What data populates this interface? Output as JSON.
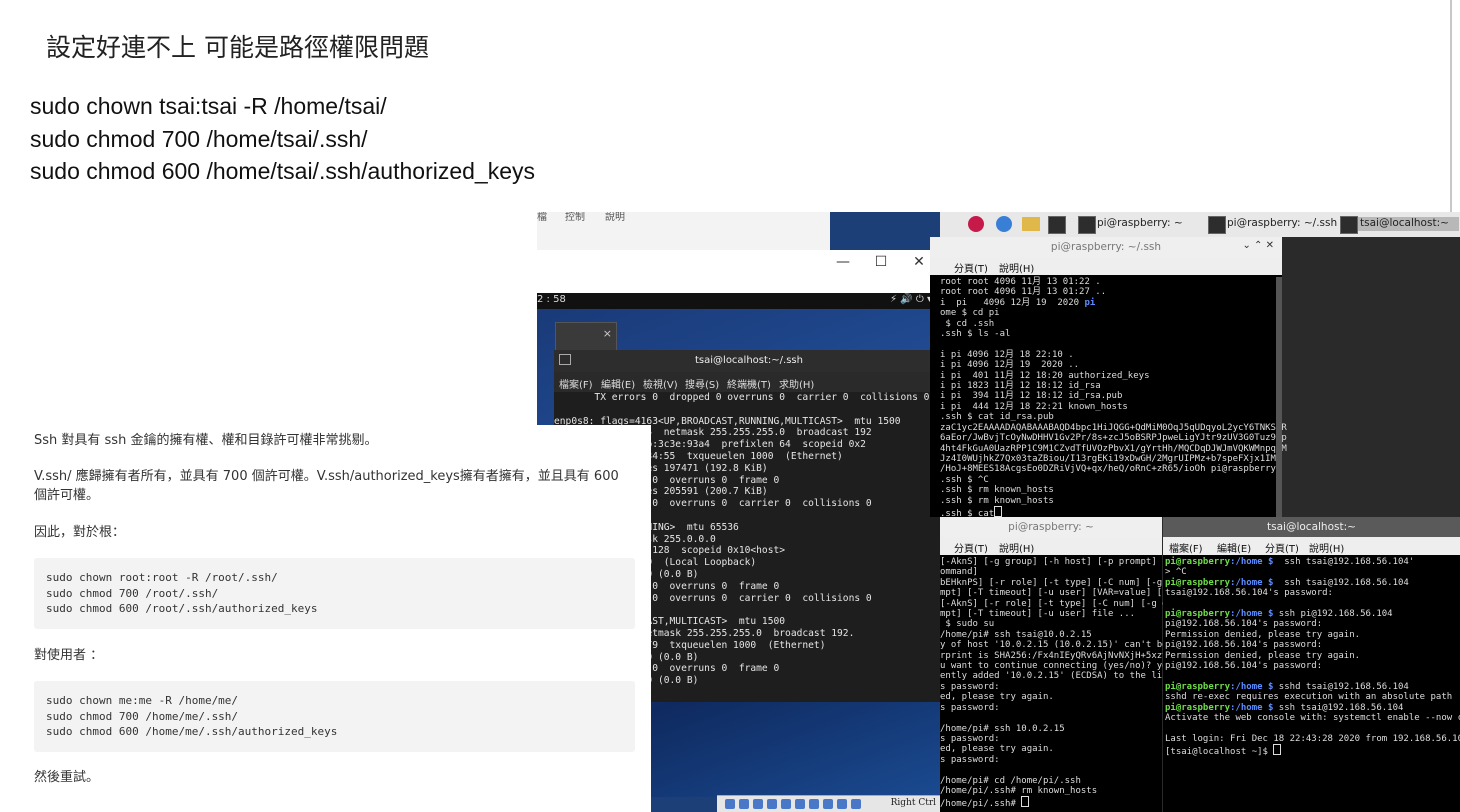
{
  "heading": "設定好連不上 可能是路徑權限問題",
  "commands": [
    "sudo chown tsai:tsai -R /home/tsai/",
    "sudo chmod 700 /home/tsai/.ssh/",
    "sudo chmod 600 /home/tsai/.ssh/authorized_keys"
  ],
  "article": {
    "p1": "Ssh 對具有 ssh 金鑰的擁有權、權和目錄許可權非常挑剔。",
    "p2": "V.ssh/ 應歸擁有者所有，並具有 700 個許可權。V.ssh/authorized_keys擁有者擁有，並且具有 600 個許可權。",
    "p3": "因此，對於根：",
    "code1": "sudo chown root:root -R /root/.ssh/\nsudo chmod 700 /root/.ssh/\nsudo chmod 600 /root/.ssh/authorized_keys",
    "p4": "對使用者 ：",
    "code2": "sudo chown me:me -R /home/me/\nsudo chmod 700 /home/me/.ssh/\nsudo chmod 600 /home/me/.ssh/authorized_keys",
    "p5": "然後重試。"
  },
  "virtualbox": {
    "top_menu": [
      "檔",
      "控制",
      "說明"
    ],
    "min": "—",
    "max": "☐",
    "close": "✕",
    "clock": "2 : 58",
    "right_ctrl": "Right Ctrl"
  },
  "gnome_terminal": {
    "title": "tsai@localhost:~/.ssh",
    "menu": [
      "檔案(F)",
      "編輯(E)",
      "檢視(V)",
      "搜尋(S)",
      "終端機(T)",
      "求助(H)"
    ],
    "output": "       TX errors 0  dropped 0 overruns 0  carrier 0  collisions 0\n\nenp0s8: flags=4163<UP,BROADCAST,RUNNING,MULTICAST>  mtu 1500\n       168.56.104  netmask 255.255.255.0  broadcast 192\n    80::d554:2cfb:3c3e:93a4  prefixlen 64  scopeid 0x2\n    08:00:27:fe:34:55  txqueuelen 1000  (Ethernet)\n    ts 1549  bytes 197471 (192.8 KiB)\n    s 0  dropped 0  overruns 0  frame 0\n    ts 1120  bytes 205591 (200.7 KiB)\n    s 0  dropped 0  overruns 0  carrier 0  collisions 0\n\n    LOOPBACK,RUNNING>  mtu 65536\n    0.0.1  netmask 255.0.0.0\n    1  prefixlen 128  scopeid 0x10<host>\n    queuelen 1000  (Local Loopback)\n    ts 0  bytes 0 (0.0 B)\n    s 0  dropped 0  overruns 0  frame 0\n    s 0  dropped 0  overruns 0  carrier 0  collisions 0\n\n    99<UP,BROADCAST,MULTICAST>  mtu 1500\n    168.122.1  netmask 255.255.255.0  broadcast 192.\n    54:00:9b:ff:79  txqueuelen 1000  (Ethernet)\n    ts 0  bytes 0 (0.0 B)\n    s 0  dropped 0  overruns 0  frame 0\n    ts 0  bytes 0 (0.0 B)"
  },
  "rpi_panel": {
    "tasks": [
      "pi@raspberry: ~",
      "pi@raspberry: ~/.ssh",
      "tsai@localhost:~"
    ]
  },
  "term_top": {
    "title": "pi@raspberry: ~/.ssh",
    "menu": [
      "分頁(T)",
      "說明(H)"
    ],
    "output_pre": "root root 4096 11月 13 01:22 .\nroot root 4096 11月 13 01:27 ..\ni  pi   4096 12月 19  2020 ",
    "output_hl": "pi",
    "output_post": "\nome $ cd pi\n $ cd .ssh\n.ssh $ ls -al\n\ni pi 4096 12月 18 22:10 .\ni pi 4096 12月 19  2020 ..\ni pi  401 11月 12 18:20 authorized_keys\ni pi 1823 11月 12 18:12 id_rsa\ni pi  394 11月 12 18:12 id_rsa.pub\ni pi  444 12月 18 22:21 known_hosts\n.ssh $ cat id_rsa.pub\nzaC1yc2EAAAADAQABAAABAQD4bpc1HiJQGG+QdMiM0OqJ5qUDqyoL2ycY6TNKSSR\n6aEor/JwBvjTcOyNwDHHV1Gv2Pr/8s+zcJ5oBSRPJpweLigYJtr9zUV3G0Tuz9pp\n4ht4FkGuA0UazRPP1C9M1CZvdTfUVOzPbvX1/gYrtHh/MQCDqDJWJmVQKWMnpqHM\nJz4I0WUjhkZ7Qx03taZBiou/I13rgEKi19xDwGH/2MgrUIPMz+b7speFXjx1IMy\n/HoJ+8MEES18AcgsEo0DZRiVjVQ+qx/heQ/oRnC+zR65/ioOh pi@raspberry\n.ssh $ ^C\n.ssh $ rm known_hosts\n.ssh $ rm known_hosts\n.ssh $ cat",
    "cursor": "cursor-block"
  },
  "term_bl": {
    "title": "pi@raspberry: ~",
    "menu": [
      "分頁(T)",
      "說明(H)"
    ],
    "output": "[-AknS] [-g group] [-h host] [-p prompt] [\nommand]\nbEHknPS] [-r role] [-t type] [-C num] [-g g\nmpt] [-T timeout] [-u user] [VAR=value] [-i\n[-AknS] [-r role] [-t type] [-C num] [-g gr\nmpt] [-T timeout] [-u user] file ...\n $ sudo su\n/home/pi# ssh tsai@10.0.2.15\ny of host '10.0.2.15 (10.0.2.15)' can't be\nrprint is SHA256:/Fx4nIEyQRv6AjNvNXjH+5xzt\nu want to continue connecting (yes/no)? yes\nently added '10.0.2.15' (ECDSA) to the list\ns password:\ned, please try again.\ns password:\n\n/home/pi# ssh 10.0.2.15\ns password:\ned, please try again.\ns password:\n\n/home/pi# cd /home/pi/.ssh\n/home/pi/.ssh# rm known_hosts\n/home/pi/.ssh# "
  },
  "term_br": {
    "title": "tsai@localhost:~",
    "menu": [
      "檔案(F)",
      "編輯(E)",
      "分頁(T)",
      "說明(H)"
    ],
    "prompt": "pi@raspberry",
    "path": ":/home $",
    "lines": [
      {
        "cmd": "  ssh tsai@192.168.56.104'",
        "out": "> ^C"
      },
      {
        "cmd": "  ssh tsai@192.168.56.104",
        "out": "tsai@192.168.56.104's password:"
      },
      {
        "cmd": " ssh pi@192.168.56.104",
        "out": "pi@192.168.56.104's password:\nPermission denied, please try again.\npi@192.168.56.104's password:\nPermission denied, please try again.\npi@192.168.56.104's password:"
      },
      {
        "cmd": " sshd tsai@192.168.56.104",
        "out": "sshd re-exec requires execution with an absolute path"
      },
      {
        "cmd": " ssh tsai@192.168.56.104",
        "out": "Activate the web console with: systemctl enable --now c\n\nLast login: Fri Dec 18 22:43:28 2020 from 192.168.56.10\n[tsai@localhost ~]$ "
      }
    ]
  },
  "colors": {
    "prompt_green": "#6fdc4a",
    "path_blue": "#5c8cff",
    "vm_bg": "#1c3f78"
  }
}
